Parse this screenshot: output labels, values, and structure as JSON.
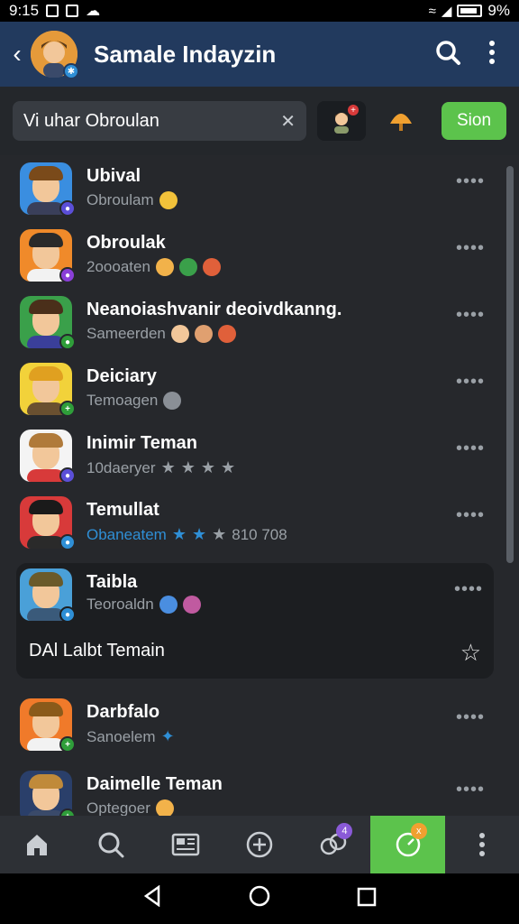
{
  "status_bar": {
    "time": "9:15",
    "battery": "9%"
  },
  "app_bar": {
    "title": "Samale Indayzin"
  },
  "search": {
    "value": "Vi uhar Obroulan",
    "send_label": "Sion"
  },
  "contacts": [
    {
      "name": "Ubival",
      "status": "Obroulam",
      "badge_color": "#5b4fd8",
      "avatar_bg": "#3a8ee0",
      "hair": "#7a4a1a",
      "shirt": "#3a3f5a"
    },
    {
      "name": "Obroulak",
      "status": "2oooaten",
      "badge_color": "#8a3fd8",
      "avatar_bg": "#f08a2a",
      "hair": "#2a2a2a",
      "shirt": "#f2f2f2"
    },
    {
      "name": "Neanoiashvanir deoivdkanng.",
      "status": "Sameerden",
      "badge_color": "#2f9e3a",
      "avatar_bg": "#3aa04a",
      "hair": "#4a2f1a",
      "shirt": "#3a3f9a"
    },
    {
      "name": "Deiciary",
      "status": "Temoagen",
      "badge_color": "#2f9e3a",
      "avatar_bg": "#f2d23a",
      "hair": "#e0a020",
      "shirt": "#6a5030"
    },
    {
      "name": "Inimir Teman",
      "status": "10daeryer",
      "badge_color": "#5b4fd8",
      "avatar_bg": "#f4f4f4",
      "hair": "#b07a3a",
      "shirt": "#d83a3a"
    },
    {
      "name": "Temullat",
      "status": "Obaneatem",
      "badge_color": "#2f8fd6",
      "avatar_bg": "#d83a3a",
      "hair": "#1a1a1a",
      "shirt": "#2a2a2a",
      "extra": "810 708"
    },
    {
      "name": "Taibla",
      "status": "Teoroaldn",
      "badge_color": "#2f8fd6",
      "avatar_bg": "#4aa0d8",
      "hair": "#6a5a2a",
      "shirt": "#3a5a7a"
    },
    {
      "name": "Darbfalo",
      "status": "Sanoelem",
      "badge_color": "#2f9e3a",
      "avatar_bg": "#f07a2a",
      "hair": "#8a5a1a",
      "shirt": "#f2f2f2"
    },
    {
      "name": "Daimelle Teman",
      "status": "Optegoer",
      "badge_color": "#2f9e3a",
      "avatar_bg": "#2a3f6a",
      "hair": "#c08a3a",
      "shirt": "#3a4a6a"
    }
  ],
  "card": {
    "link_label": "DAl Lalbt Temain"
  },
  "bottom_nav": {
    "badge_a": "4",
    "badge_b": "x"
  },
  "colors": {
    "app_bar": "#223a5e",
    "accent_green": "#5cc34c",
    "link_blue": "#2f8fd6"
  }
}
